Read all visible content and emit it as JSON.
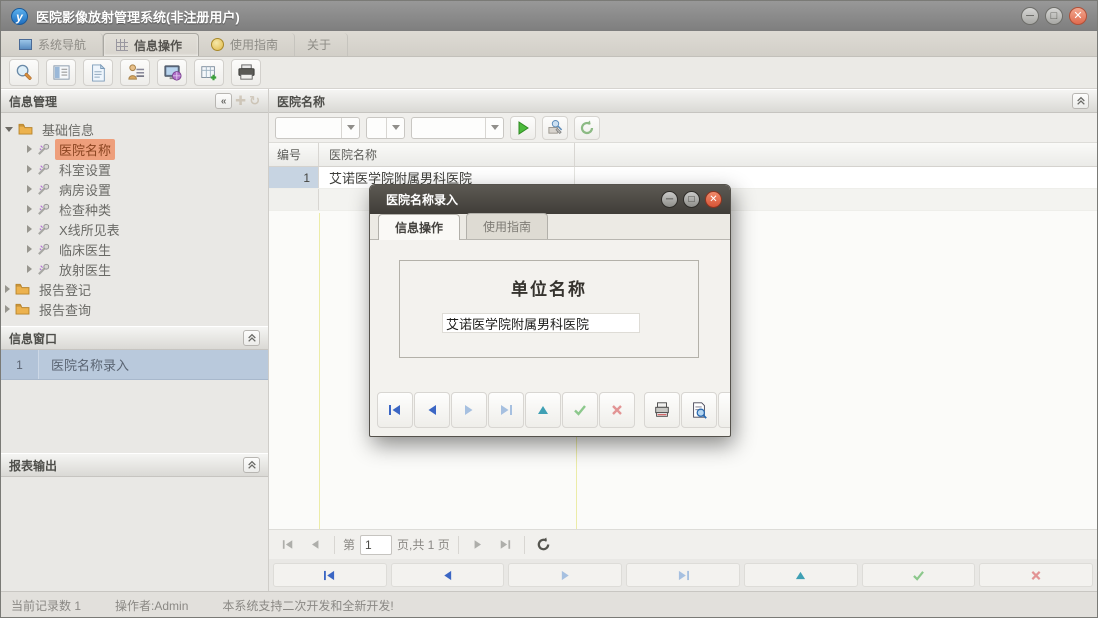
{
  "window": {
    "title": "医院影像放射管理系统(非注册用户)",
    "app_icon_letter": "y",
    "controls": {
      "minimize": "−",
      "maximize": "□",
      "close": "×"
    }
  },
  "tabs": [
    {
      "label": "系统导航",
      "icon": "blue-square-icon",
      "active": false
    },
    {
      "label": "信息操作",
      "icon": "grid-icon",
      "active": true
    },
    {
      "label": "使用指南",
      "icon": "gold-coin-icon",
      "active": false
    },
    {
      "label": "关于",
      "icon": "",
      "active": false
    }
  ],
  "toolbar": {
    "icons": [
      "search-icon",
      "form-view-icon",
      "document-icon",
      "user-settings-icon",
      "monitor-globe-icon",
      "table-add-icon",
      "printer-icon"
    ]
  },
  "sidebar": {
    "info_management": {
      "title": "信息管理",
      "header_icons": [
        "collapse-left-icon",
        "add-icon",
        "refresh-icon"
      ],
      "tree": [
        {
          "label": "基础信息",
          "type": "folder",
          "expanded": true
        },
        {
          "label": "医院名称",
          "type": "item",
          "selected": true
        },
        {
          "label": "科室设置",
          "type": "item"
        },
        {
          "label": "病房设置",
          "type": "item"
        },
        {
          "label": "检查种类",
          "type": "item"
        },
        {
          "label": "X线所见表",
          "type": "item"
        },
        {
          "label": "临床医生",
          "type": "item"
        },
        {
          "label": "放射医生",
          "type": "item"
        },
        {
          "label": "报告登记",
          "type": "folder",
          "expanded": false
        },
        {
          "label": "报告查询",
          "type": "folder",
          "expanded": false
        }
      ]
    },
    "info_window": {
      "title": "信息窗口",
      "rows": [
        {
          "num": "1",
          "label": "医院名称录入"
        }
      ]
    },
    "report_output": {
      "title": "报表输出"
    }
  },
  "main": {
    "panel_title": "医院名称",
    "query_icons": [
      "run-icon",
      "search-edit-icon",
      "refresh-icon"
    ],
    "table": {
      "columns": [
        "编号",
        "医院名称"
      ],
      "rows": [
        {
          "num": "1",
          "name": "艾诺医学院附属男科医院"
        }
      ]
    },
    "pager": {
      "page_prefix": "第",
      "page_value": "1",
      "page_suffix": "页,共 1 页",
      "icons": [
        "first-page-icon",
        "prev-page-icon",
        "next-page-icon",
        "last-page-icon",
        "refresh-icon"
      ]
    },
    "bottom_nav_icons": [
      "first-record-icon",
      "prev-record-icon",
      "next-record-icon",
      "last-record-icon",
      "insert-record-icon",
      "post-record-icon",
      "cancel-record-icon"
    ]
  },
  "dialog": {
    "title": "医院名称录入",
    "controls": {
      "minimize": "−",
      "maximize": "□",
      "close": "×"
    },
    "tabs": [
      {
        "label": "信息操作",
        "active": true
      },
      {
        "label": "使用指南",
        "active": false
      }
    ],
    "field_label": "单位名称",
    "field_value": "艾诺医学院附属男科医院",
    "nav_icons": [
      "first-record-icon",
      "prev-record-icon",
      "next-record-icon",
      "last-record-icon",
      "insert-record-icon",
      "post-record-icon",
      "cancel-record-icon",
      "print-icon",
      "print-preview-icon"
    ]
  },
  "statusbar": {
    "record_count": "当前记录数 1",
    "operator": "操作者:Admin",
    "message": "本系统支持二次开发和全新开发!"
  },
  "colors": {
    "selected_tree_bg": "#ee9f7c",
    "info_row_bg": "#b9c9dc",
    "selected_cell_bg": "#c7d4e2",
    "dialog_titlebar": "#4a4741",
    "accent_green": "#4cbb3c",
    "nav_blue": "#3b66c4",
    "nav_pale_blue": "#a6c0e0",
    "nav_teal": "#3fa0b4",
    "nav_green": "#8cc88c",
    "nav_red": "#e29494"
  }
}
